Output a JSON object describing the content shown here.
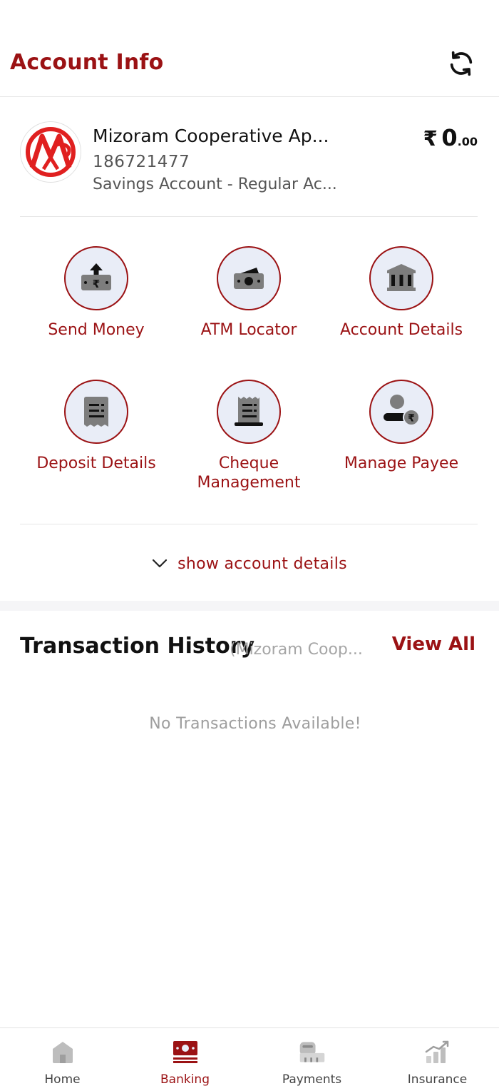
{
  "header": {
    "title": "Account Info",
    "refresh_icon": "refresh-icon"
  },
  "account": {
    "bank_name": "Mizoram Cooperative Ap...",
    "account_number": "186721477",
    "account_type": "Savings Account - Regular Ac...",
    "balance": {
      "currency_symbol": "₹",
      "integer": "0",
      "decimal": ".00"
    }
  },
  "actions": [
    {
      "label": "Send Money",
      "icon": "send-money-icon"
    },
    {
      "label": "ATM Locator",
      "icon": "atm-icon"
    },
    {
      "label": "Account Details",
      "icon": "bank-icon"
    },
    {
      "label": "Deposit Details",
      "icon": "receipt-icon"
    },
    {
      "label": "Cheque Management",
      "icon": "cheque-icon"
    },
    {
      "label": "Manage Payee",
      "icon": "payee-icon"
    }
  ],
  "toggle": {
    "label": "show account details",
    "icon": "chevron-down-icon"
  },
  "transaction_history": {
    "title": "Transaction History",
    "bank": "(Mizoram Coop...",
    "view_all": "View All",
    "empty_message": "No Transactions Available!"
  },
  "bottom_nav": {
    "active": "Banking",
    "items": [
      {
        "label": "Home",
        "icon": "home-icon"
      },
      {
        "label": "Banking",
        "icon": "banking-icon"
      },
      {
        "label": "Payments",
        "icon": "payments-icon"
      },
      {
        "label": "Insurance",
        "icon": "insurance-icon"
      }
    ]
  },
  "colors": {
    "brand": "#9b1214",
    "icon_bg": "#e9edf7",
    "muted_text": "#9e9e9e"
  }
}
